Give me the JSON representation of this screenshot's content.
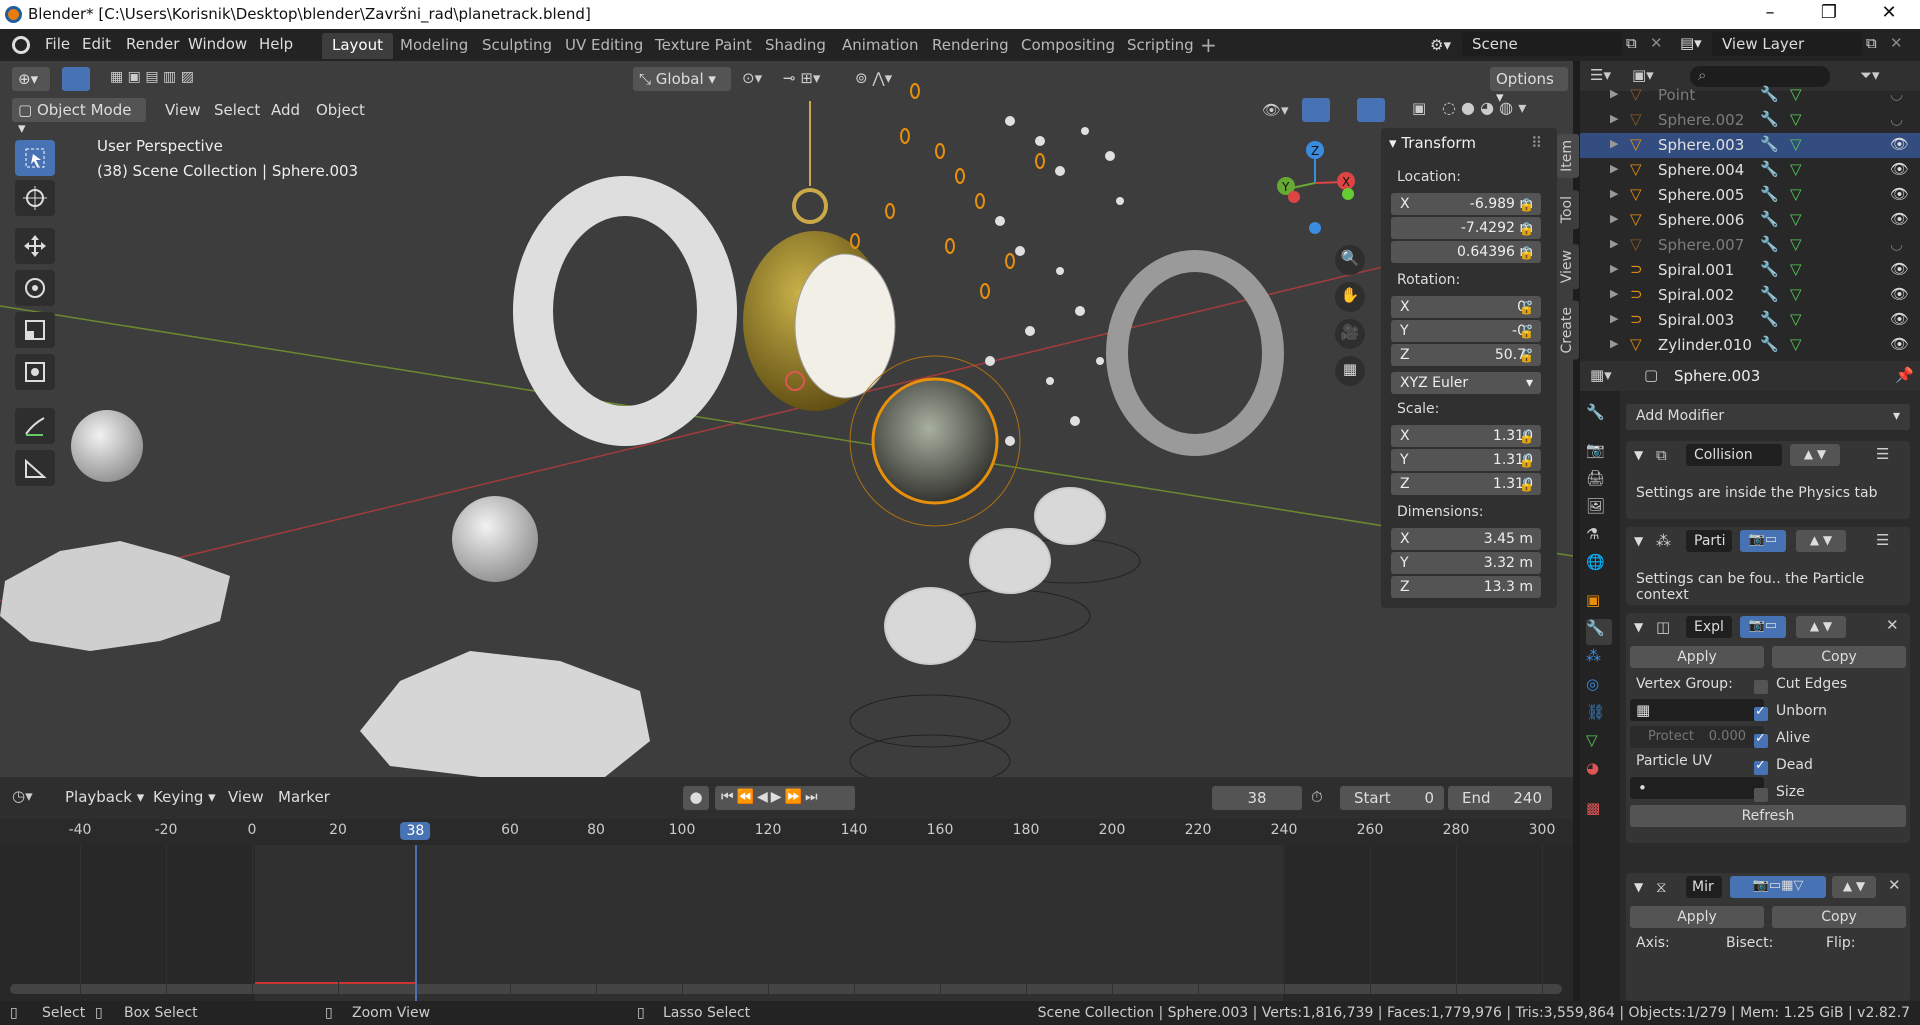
{
  "titlebar": {
    "title": "Blender* [C:\\Users\\Korisnik\\Desktop\\blender\\Završni_rad\\planetrack.blend]"
  },
  "menu": [
    "File",
    "Edit",
    "Render",
    "Window",
    "Help"
  ],
  "workspaces": [
    "Layout",
    "Modeling",
    "Sculpting",
    "UV Editing",
    "Texture Paint",
    "Shading",
    "Animation",
    "Rendering",
    "Compositing",
    "Scripting"
  ],
  "scene": {
    "label": "Scene",
    "view_layer": "View Layer"
  },
  "viewport": {
    "mode": "Object Mode",
    "menus": [
      "View",
      "Select",
      "Add",
      "Object"
    ],
    "orientation": "Global",
    "options": "Options",
    "info_line1": "User Perspective",
    "info_line2": "(38) Scene Collection | Sphere.003",
    "gizmo": {
      "x": "X",
      "y": "Y",
      "z": "Z"
    }
  },
  "npanel": {
    "header": "Transform",
    "location_label": "Location:",
    "location": [
      {
        "ax": "X",
        "v": "-6.989 m"
      },
      {
        "ax": "",
        "v": "-7.4292 m"
      },
      {
        "ax": "",
        "v": "0.64396 m"
      }
    ],
    "rotation_label": "Rotation:",
    "rotation": [
      {
        "ax": "X",
        "v": "0°"
      },
      {
        "ax": "Y",
        "v": "-0°"
      },
      {
        "ax": "Z",
        "v": "50.7°"
      }
    ],
    "rotation_mode": "XYZ Euler",
    "scale_label": "Scale:",
    "scale": [
      {
        "ax": "X",
        "v": "1.310"
      },
      {
        "ax": "Y",
        "v": "1.310"
      },
      {
        "ax": "Z",
        "v": "1.310"
      }
    ],
    "dimensions_label": "Dimensions:",
    "dimensions": [
      {
        "ax": "X",
        "v": "3.45 m"
      },
      {
        "ax": "Y",
        "v": "3.32 m"
      },
      {
        "ax": "Z",
        "v": "13.3 m"
      }
    ],
    "tabs": [
      "Item",
      "Tool",
      "View",
      "Create"
    ]
  },
  "outliner": {
    "rows": [
      {
        "name": "Point",
        "dim": true
      },
      {
        "name": "Sphere.002",
        "dim": true
      },
      {
        "name": "Sphere.003",
        "selected": true
      },
      {
        "name": "Sphere.004"
      },
      {
        "name": "Sphere.005"
      },
      {
        "name": "Sphere.006"
      },
      {
        "name": "Sphere.007",
        "dim": true
      },
      {
        "name": "Spiral.001"
      },
      {
        "name": "Spiral.002"
      },
      {
        "name": "Spiral.003"
      },
      {
        "name": "Zylinder.010"
      }
    ]
  },
  "properties": {
    "object": "Sphere.003",
    "add_modifier": "Add Modifier",
    "collision": {
      "name": "Collision",
      "note": "Settings are inside the Physics tab"
    },
    "particles": {
      "name": "Parti",
      "note": "Settings can be fou.. the Particle context"
    },
    "explode": {
      "name": "Expl",
      "apply": "Apply",
      "copy": "Copy",
      "vertex_group": "Vertex Group:",
      "protect": "Protect",
      "protect_val": "0.000",
      "particle_uv": "Particle UV",
      "cut_edges": "Cut Edges",
      "unborn": "Unborn",
      "alive": "Alive",
      "dead": "Dead",
      "size": "Size",
      "refresh": "Refresh"
    },
    "mirror": {
      "name": "Mir",
      "apply": "Apply",
      "copy": "Copy",
      "axis": "Axis:",
      "bisect": "Bisect:",
      "flip": "Flip:"
    }
  },
  "timeline": {
    "menus": [
      "Playback",
      "Keying",
      "View",
      "Marker"
    ],
    "current_frame": "38",
    "start_label": "Start",
    "start": "0",
    "end_label": "End",
    "end": "240",
    "ticks": [
      "-40",
      "-20",
      "0",
      "20",
      "38",
      "60",
      "80",
      "100",
      "120",
      "140",
      "160",
      "180",
      "200",
      "220",
      "240",
      "260",
      "280",
      "300"
    ]
  },
  "status": {
    "select": "Select",
    "box_select": "Box Select",
    "zoom_view": "Zoom View",
    "lasso": "Lasso Select",
    "stats": "Scene Collection | Sphere.003 | Verts:1,816,739 | Faces:1,779,976 | Tris:3,559,864 | Objects:1/279 | Mem: 1.25 GiB | v2.82.7"
  },
  "colors": {
    "accent": "#4772b3",
    "selection": "#e8900c",
    "bg": "#3d3d3d"
  }
}
